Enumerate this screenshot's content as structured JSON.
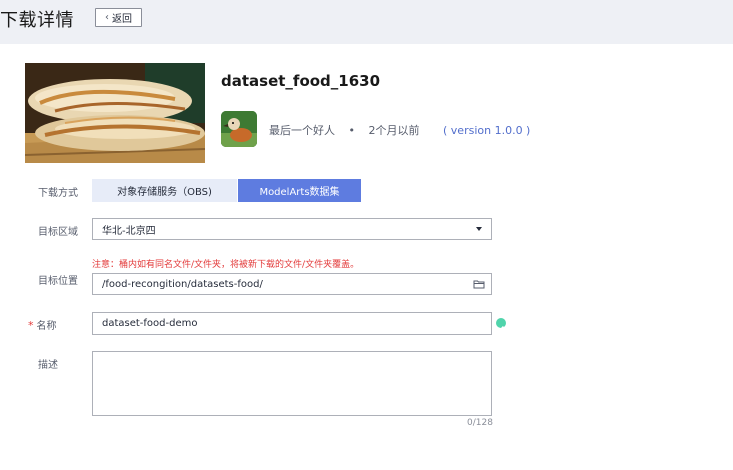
{
  "header": {
    "title": "下载详情",
    "back_label": "返回"
  },
  "dataset": {
    "name": "dataset_food_1630",
    "author": "最后一个好人",
    "separator": "•",
    "updated": "2个月以前",
    "version": "( version 1.0.0 )"
  },
  "form": {
    "download_method_label": "下载方式",
    "tabs": [
      {
        "label": "对象存储服务（OBS)",
        "selected": false
      },
      {
        "label": "ModelArts数据集",
        "selected": true
      }
    ],
    "region_label": "目标区域",
    "region_value": "华北-北京四",
    "location_label": "目标位置",
    "location_notice": "注意：桶内如有同名文件/文件夹，将被新下载的文件/文件夹覆盖。",
    "location_value": "/food-recongition/datasets-food/",
    "name_required_mark": "*",
    "name_label": "名称",
    "name_value": "dataset-food-demo",
    "description_label": "描述",
    "description_value": "",
    "description_counter": "0/128"
  },
  "icons": {
    "back": "chevron-left-icon",
    "dropdown": "caret-down-icon",
    "folder": "folder-icon",
    "valid": "check-circle-icon"
  },
  "colors": {
    "primary": "#5e7ce0",
    "tab_inactive": "#e7ecf8",
    "warning": "#e33b3b",
    "success": "#50d4ab",
    "version_link": "#526ecc"
  }
}
